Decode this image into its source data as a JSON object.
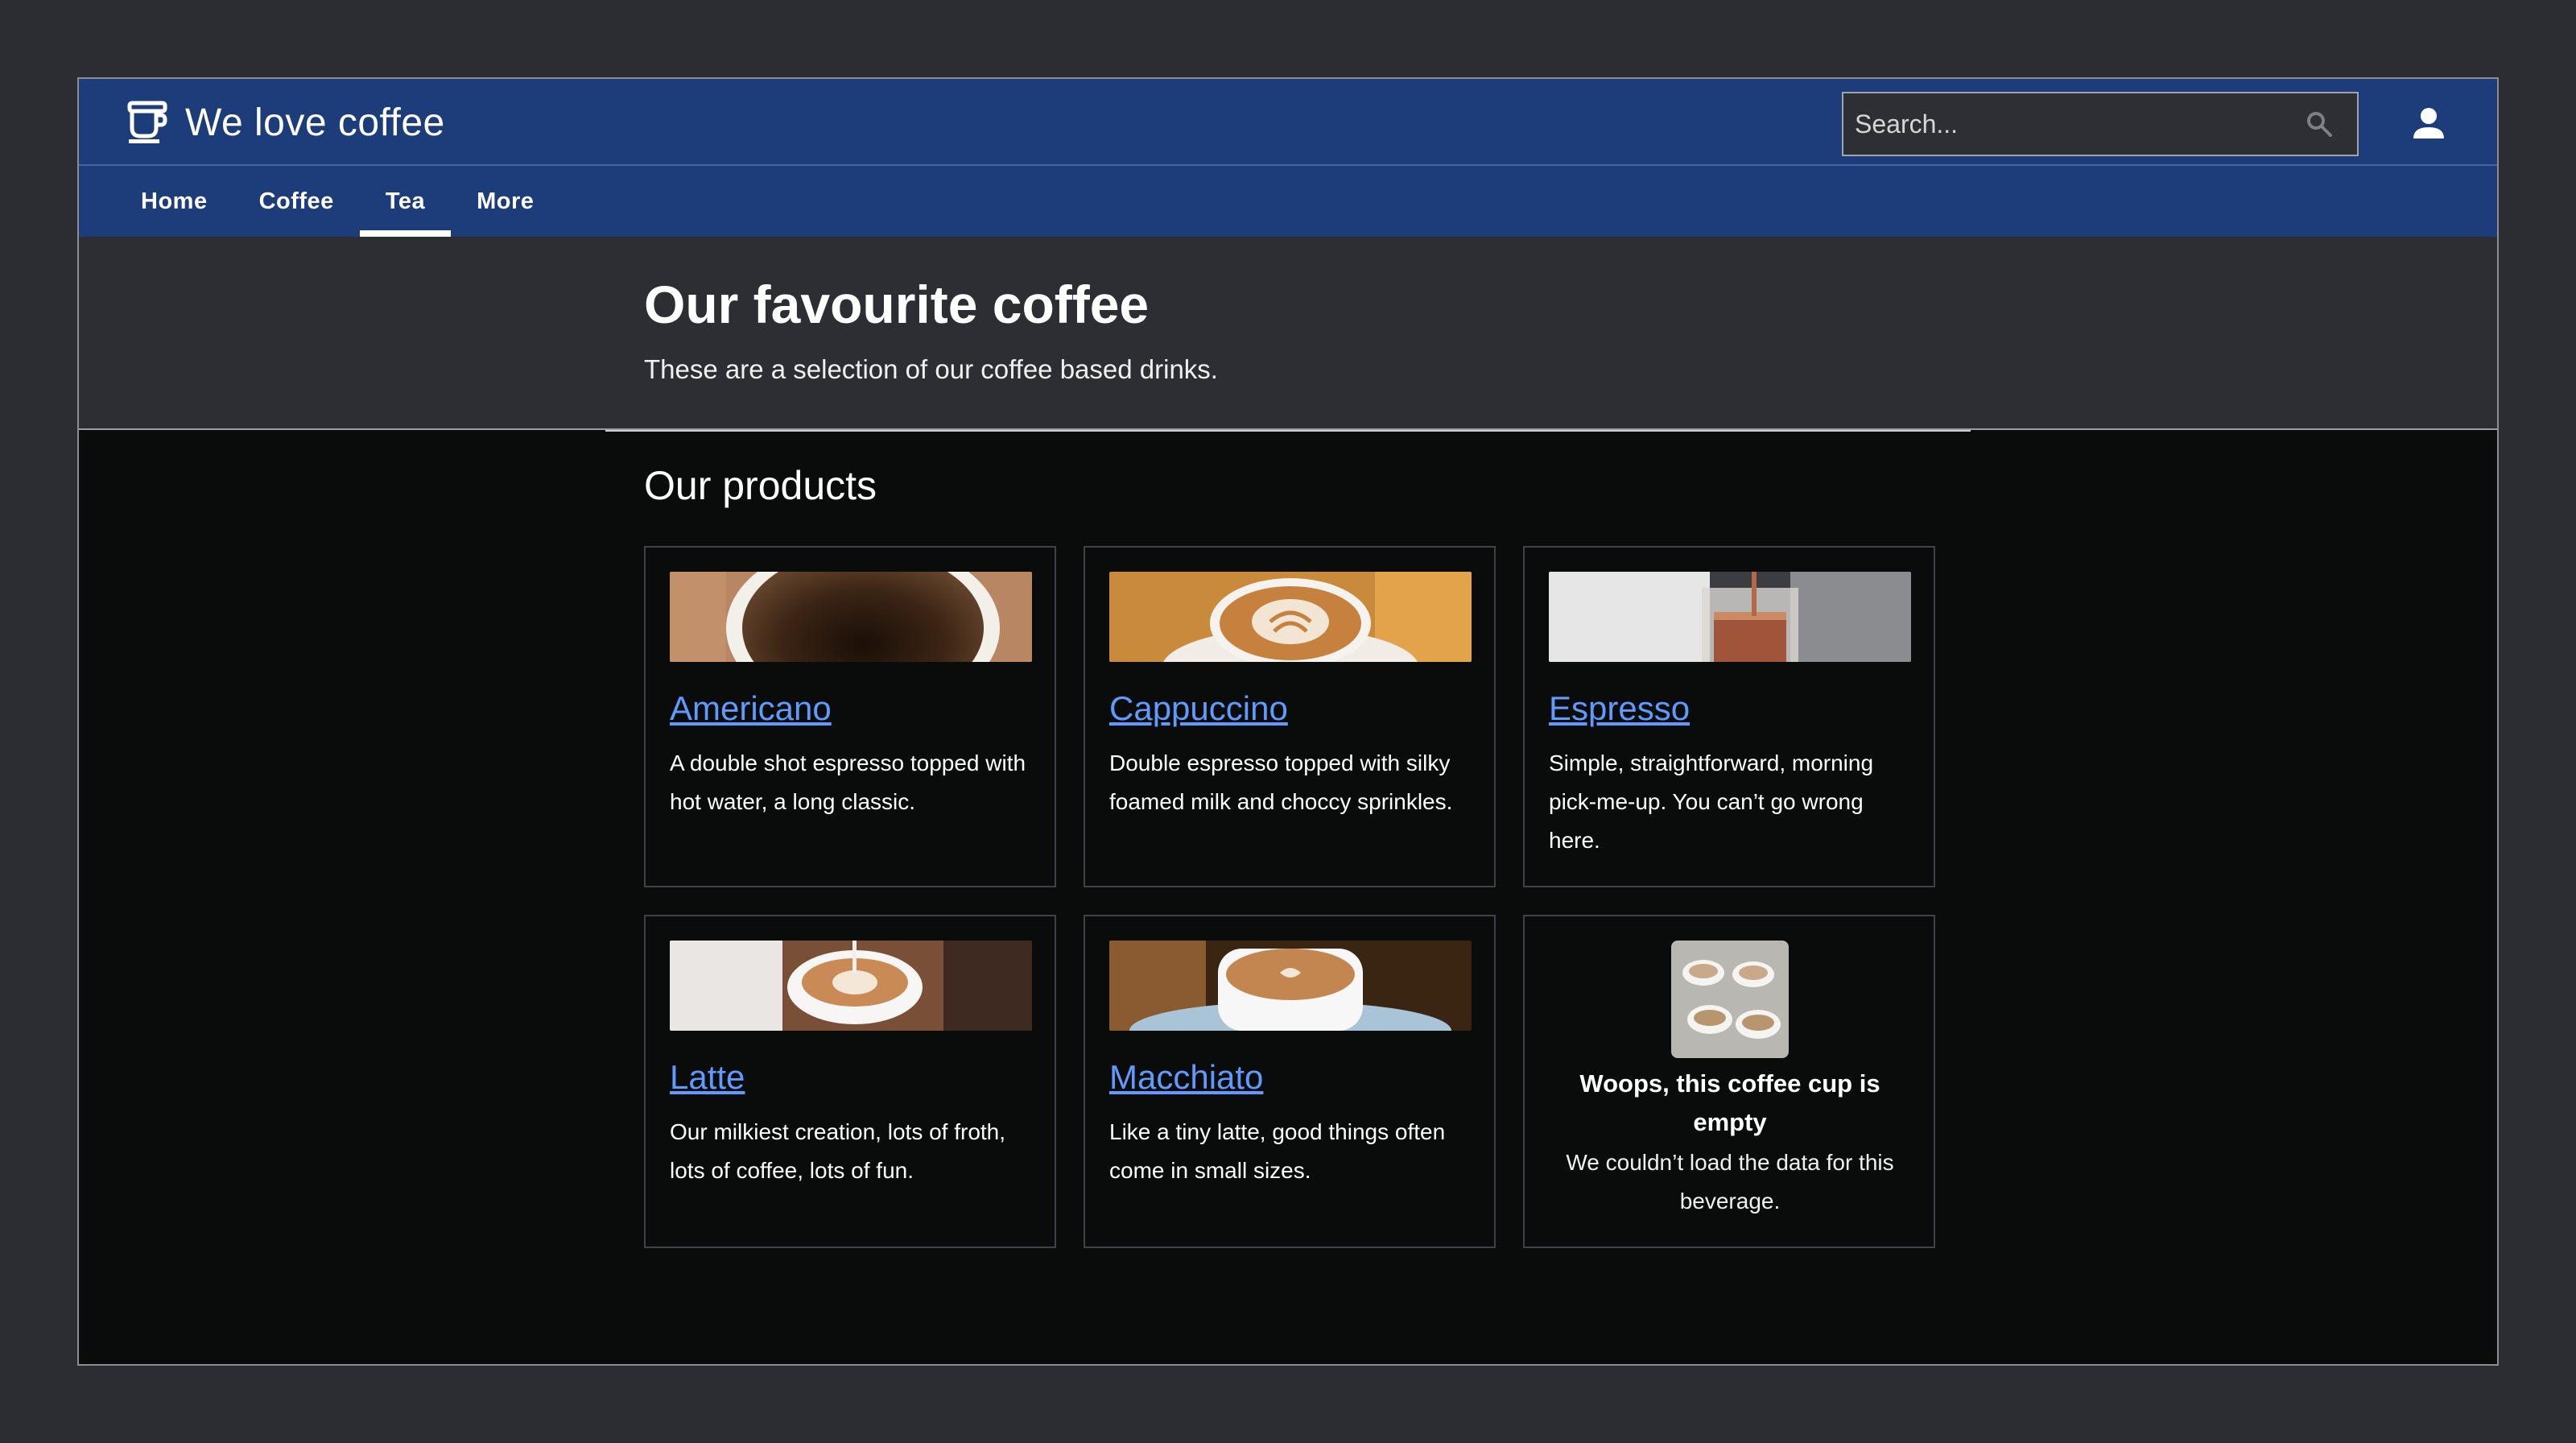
{
  "header": {
    "app_title": "We love coffee",
    "search_placeholder": "Search...",
    "search_value": ""
  },
  "nav": {
    "tabs": [
      {
        "label": "Home"
      },
      {
        "label": "Coffee"
      },
      {
        "label": "Tea"
      },
      {
        "label": "More"
      }
    ],
    "active": "Tea"
  },
  "hero": {
    "title": "Our favourite coffee",
    "subtitle": "These are a selection of our coffee based drinks."
  },
  "products": {
    "heading": "Our products",
    "items": [
      {
        "name": "Americano",
        "description": "A double shot espresso topped with hot water, a long classic."
      },
      {
        "name": "Cappuccino",
        "description": "Double espresso topped with silky foamed milk and choccy sprinkles."
      },
      {
        "name": "Espresso",
        "description": "Simple, straightforward, morning pick-me-up. You can’t go wrong here."
      },
      {
        "name": "Latte",
        "description": "Our milkiest creation, lots of froth, lots of coffee, lots of fun."
      },
      {
        "name": "Macchiato",
        "description": "Like a tiny latte, good things often come in small sizes."
      }
    ],
    "empty_state": {
      "title": "Woops, this coffee cup is empty",
      "description": "We couldn’t load the data for this beverage."
    }
  },
  "colors": {
    "header_bg": "#1d3c7a",
    "link": "#5f9bff",
    "hero_bg": "#2c2e33",
    "page_bg": "#0a0b0b"
  },
  "icons": [
    "coffee-cup-icon",
    "search-icon",
    "user-icon"
  ]
}
